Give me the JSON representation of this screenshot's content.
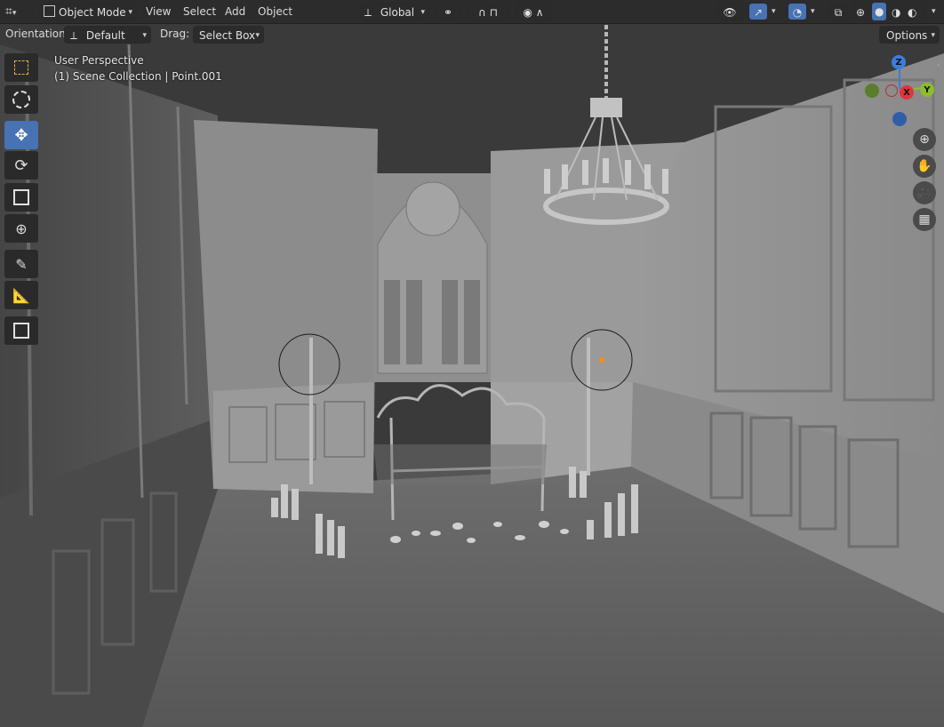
{
  "header": {
    "mode_label": "Object Mode",
    "menus": [
      "View",
      "Select",
      "Add",
      "Object"
    ],
    "transform_orientation": "Global"
  },
  "tool_settings": {
    "orientation_label": "Orientation:",
    "orientation_value": "Default",
    "drag_label": "Drag:",
    "drag_value": "Select Box",
    "options_label": "Options"
  },
  "viewport": {
    "view_name": "User Perspective",
    "collection_info": "(1) Scene Collection | Point.001"
  },
  "gizmo": {
    "z_label": "Z",
    "y_label": "Y",
    "x_label": "X",
    "colors": {
      "x": "#e0353d",
      "y": "#8cbc2f",
      "z": "#3c7ddc"
    }
  },
  "toolbar": {
    "tools": [
      "select-box",
      "cursor",
      "move",
      "rotate",
      "scale",
      "transform",
      "annotate",
      "measure",
      "add-cube"
    ],
    "active_tool": "move"
  },
  "colors": {
    "accent": "#4772b3",
    "header_bg": "#2c2c2c"
  }
}
